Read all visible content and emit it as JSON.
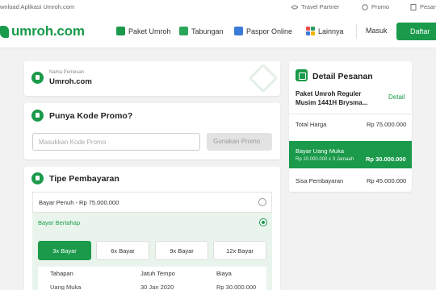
{
  "top_strip": {
    "download": "wnload Aplikasi Umroh.com",
    "links": [
      "Travel Partner",
      "Promo",
      "Pesan"
    ]
  },
  "navbar": {
    "logo": "umroh.com",
    "items": [
      "Paket Umroh",
      "Tabungan",
      "Paspor Online",
      "Lainnya"
    ],
    "masuk": "Masuk",
    "daftar": "Daftar"
  },
  "customer": {
    "label": "Nama Pemesan",
    "value": "Umroh.com"
  },
  "promo": {
    "title": "Punya Kode Promo?",
    "placeholder": "Masukkan Kode Promo",
    "button": "Gunakan Promo"
  },
  "payment": {
    "title": "Tipe Pembayaran",
    "options": [
      {
        "label": "Bayar Penuh - Rp 75.000.000",
        "selected": false
      },
      {
        "label": "Bayar Bertahap",
        "selected": true
      }
    ],
    "installments": [
      "3x Bayar",
      "6x Bayar",
      "9x Bayar",
      "12x Bayar"
    ],
    "active_installment": "3x Bayar",
    "table": {
      "headers": [
        "Tahapan",
        "Jatuh Tempo",
        "Biaya"
      ],
      "rows": [
        [
          "Uang Muka",
          "30 Jan 2020",
          "Rp 30.000.000"
        ]
      ]
    }
  },
  "order_detail": {
    "title": "Detail Pesanan",
    "package": "Paket Umroh Reguler Musim 1441H Brysma...",
    "detail_link": "Detail",
    "total_label": "Total Harga",
    "total_value": "Rp 75.000.000",
    "dp_label": "Bayar Uang Muka",
    "dp_sub": "Rp 10.000.000 x 3 Jamaah",
    "dp_value": "Rp 30.000.000",
    "rest_label": "Sisa Pembayaran",
    "rest_value": "Rp 45.000.000"
  },
  "colors": {
    "brand_green": "#1a9a4a",
    "light_green": "#e9f5ec"
  },
  "icons": [
    "handshake-icon",
    "promo-tag-icon",
    "receipt-icon",
    "user-icon",
    "promo-icon",
    "payment-icon",
    "document-icon",
    "box-icon",
    "wallet-icon",
    "passport-icon",
    "grid-icon"
  ]
}
